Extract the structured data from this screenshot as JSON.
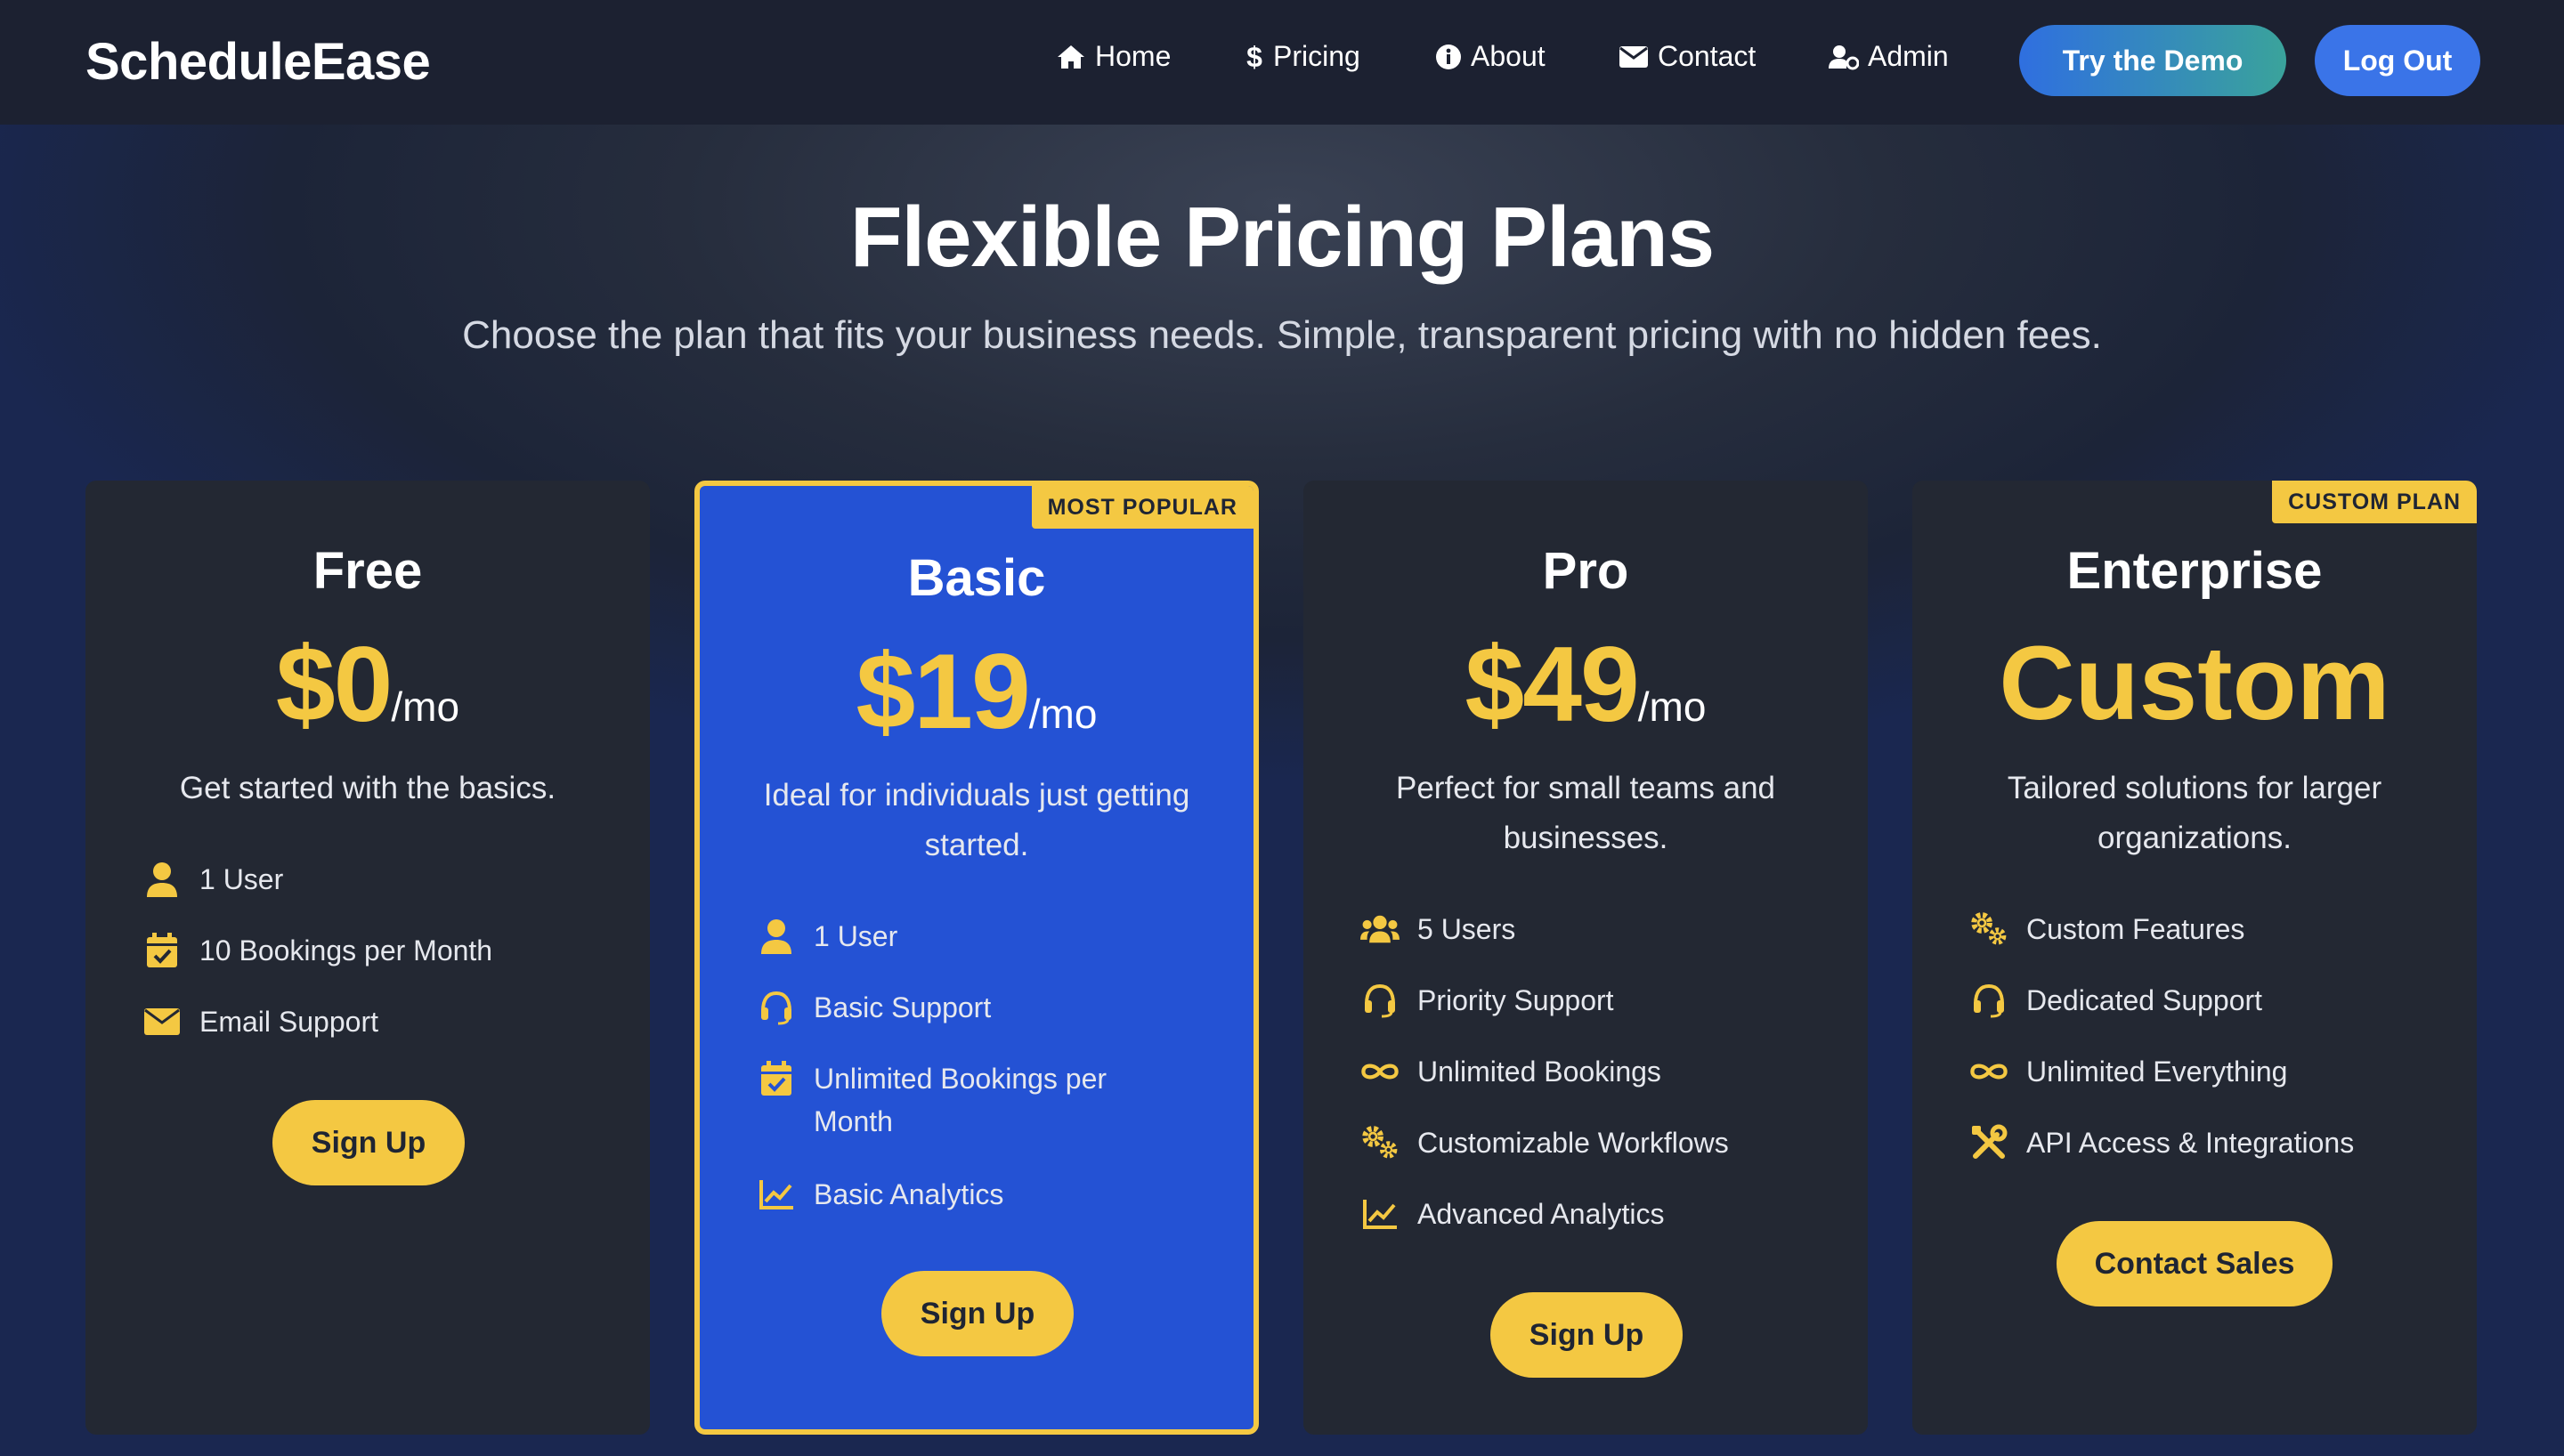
{
  "colors": {
    "accent": "#f4c842",
    "popular_card": "#2452d4",
    "card": "#232833",
    "demo_gradient_start": "#2f6fe0",
    "demo_gradient_end": "#3aa39b",
    "logout": "#3a74e8"
  },
  "header": {
    "logo": "ScheduleEase",
    "nav": [
      {
        "label": "Home",
        "icon": "home-icon"
      },
      {
        "label": "Pricing",
        "icon": "dollar-icon"
      },
      {
        "label": "About",
        "icon": "info-icon"
      },
      {
        "label": "Contact",
        "icon": "envelope-icon"
      },
      {
        "label": "Admin",
        "icon": "user-cog-icon"
      }
    ],
    "demo_button": "Try the Demo",
    "logout_button": "Log Out"
  },
  "hero": {
    "title": "Flexible Pricing Plans",
    "subtitle": "Choose the plan that fits your business needs. Simple, transparent pricing with no hidden fees."
  },
  "plans": [
    {
      "name": "Free",
      "price": "$0",
      "period": "/mo",
      "description": "Get started with the basics.",
      "features": [
        {
          "icon": "user-icon",
          "text": "1 User"
        },
        {
          "icon": "calendar-check-icon",
          "text": "10 Bookings per Month"
        },
        {
          "icon": "envelope-icon",
          "text": "Email Support"
        }
      ],
      "button": "Sign Up"
    },
    {
      "name": "Basic",
      "price": "$19",
      "period": "/mo",
      "badge": "MOST POPULAR",
      "description": "Ideal for individuals just getting started.",
      "features": [
        {
          "icon": "user-icon",
          "text": "1 User"
        },
        {
          "icon": "headset-icon",
          "text": "Basic Support"
        },
        {
          "icon": "calendar-check-icon",
          "text": "Unlimited Bookings per Month"
        },
        {
          "icon": "chart-line-icon",
          "text": "Basic Analytics"
        }
      ],
      "button": "Sign Up"
    },
    {
      "name": "Pro",
      "price": "$49",
      "period": "/mo",
      "description": "Perfect for small teams and businesses.",
      "features": [
        {
          "icon": "users-icon",
          "text": "5 Users"
        },
        {
          "icon": "headset-icon",
          "text": "Priority Support"
        },
        {
          "icon": "infinity-icon",
          "text": "Unlimited Bookings"
        },
        {
          "icon": "cogs-icon",
          "text": "Customizable Workflows"
        },
        {
          "icon": "chart-line-icon",
          "text": "Advanced Analytics"
        }
      ],
      "button": "Sign Up"
    },
    {
      "name": "Enterprise",
      "price": "Custom",
      "badge": "CUSTOM PLAN",
      "description": "Tailored solutions for larger organizations.",
      "features": [
        {
          "icon": "cogs-icon",
          "text": "Custom Features"
        },
        {
          "icon": "headset-icon",
          "text": "Dedicated Support"
        },
        {
          "icon": "infinity-icon",
          "text": "Unlimited Everything"
        },
        {
          "icon": "tools-icon",
          "text": "API Access & Integrations"
        }
      ],
      "button": "Contact Sales"
    }
  ]
}
